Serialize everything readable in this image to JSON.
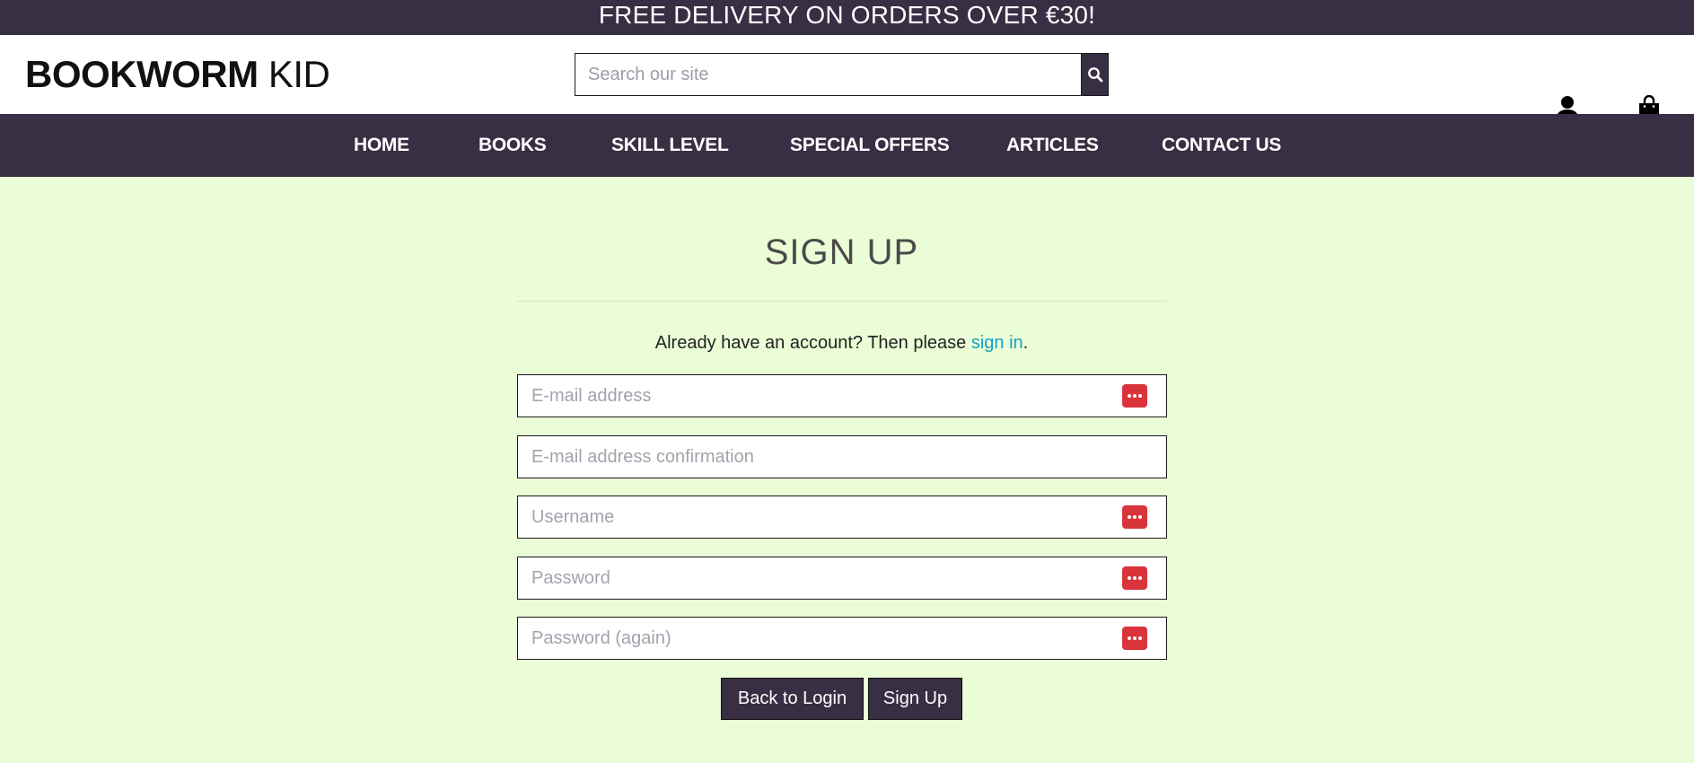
{
  "promo": {
    "text": "FREE DELIVERY ON ORDERS OVER €30!"
  },
  "header": {
    "logo_strong": "BOOKWORM",
    "logo_light": "KID",
    "search_placeholder": "Search our site",
    "account_icon": "user-icon",
    "cart_icon": "shopping-bag-icon"
  },
  "nav": {
    "items": [
      {
        "label": "HOME"
      },
      {
        "label": "BOOKS"
      },
      {
        "label": "SKILL LEVEL"
      },
      {
        "label": "SPECIAL OFFERS"
      },
      {
        "label": "ARTICLES"
      },
      {
        "label": "CONTACT US"
      }
    ]
  },
  "signup": {
    "title": "SIGN UP",
    "prompt_text": "Already have an account? Then please ",
    "prompt_link": "sign in",
    "prompt_end": ".",
    "fields": {
      "email": {
        "placeholder": "E-mail address"
      },
      "email_confirm": {
        "placeholder": "E-mail address confirmation"
      },
      "username": {
        "placeholder": "Username"
      },
      "password": {
        "placeholder": "Password"
      },
      "password_again": {
        "placeholder": "Password (again)"
      }
    },
    "password_manager_icon": "password-manager-icon",
    "back_button": "Back to Login",
    "submit_button": "Sign Up"
  },
  "colors": {
    "brand_dark": "#382f44",
    "page_background": "#eafdd6",
    "link": "#179fc2",
    "password_manager": "#d9333b"
  }
}
